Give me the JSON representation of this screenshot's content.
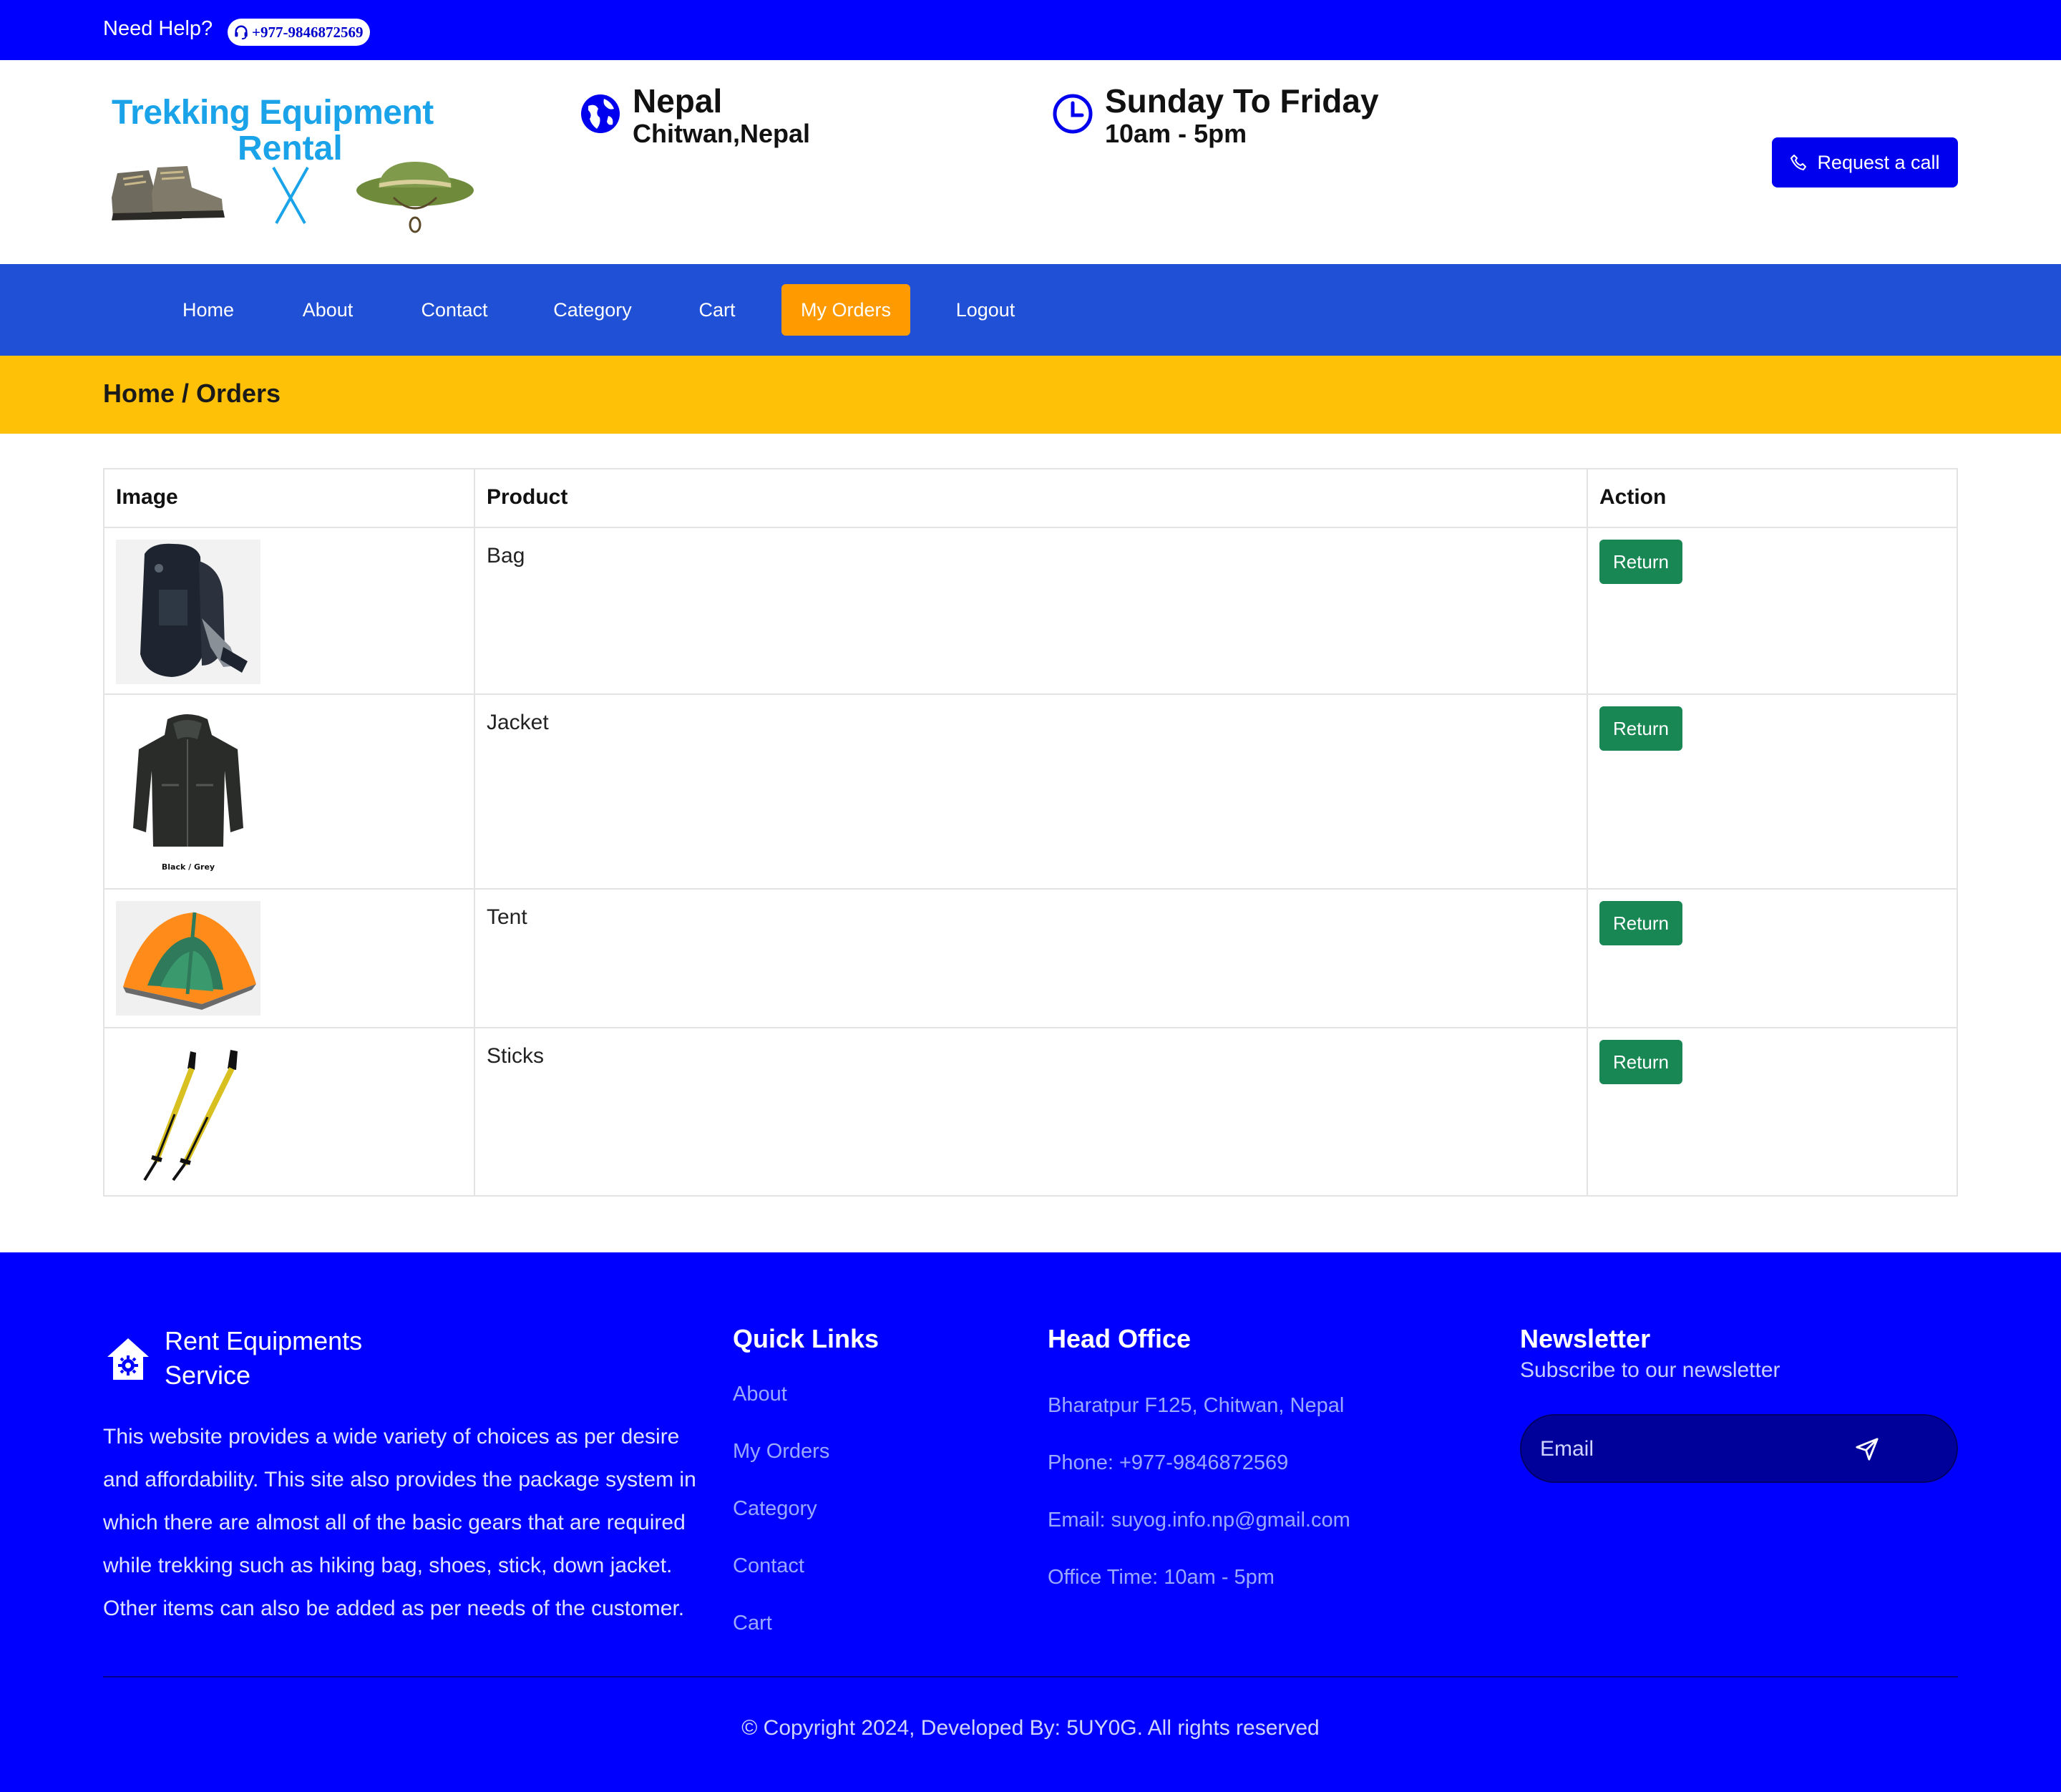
{
  "topbar": {
    "help": "Need Help?",
    "phone": "+977-9846872569"
  },
  "header": {
    "logo_line1": "Trekking Equipment",
    "logo_line2": "Rental",
    "location_title": "Nepal",
    "location_sub": "Chitwan,Nepal",
    "hours_title": "Sunday To Friday",
    "hours_sub": "10am - 5pm",
    "request_call": "Request a call"
  },
  "nav": {
    "items": [
      "Home",
      "About",
      "Contact",
      "Category",
      "Cart",
      "My Orders",
      "Logout"
    ],
    "active": "My Orders"
  },
  "breadcrumb": "Home / Orders",
  "table": {
    "headers": [
      "Image",
      "Product",
      "Action"
    ],
    "rows": [
      {
        "product": "Bag",
        "action": "Return"
      },
      {
        "product": "Jacket",
        "action": "Return"
      },
      {
        "product": "Tent",
        "action": "Return"
      },
      {
        "product": "Sticks",
        "action": "Return"
      }
    ],
    "jacket_caption": "Black / Grey"
  },
  "footer": {
    "brand_line1": "Rent Equipments",
    "brand_line2": "Service",
    "description": "This website provides a wide variety of choices as per desire and affordability. This site also provides the package system in which there are almost all of the basic gears that are required while trekking such as hiking bag, shoes, stick, down jacket. Other items can also be added as per needs of the customer.",
    "quick_links_title": "Quick Links",
    "quick_links": [
      "About",
      "My Orders",
      "Category",
      "Contact",
      "Cart"
    ],
    "office_title": "Head Office",
    "office": [
      "Bharatpur F125, Chitwan, Nepal",
      "Phone: +977-9846872569",
      "Email: suyog.info.np@gmail.com",
      "Office Time: 10am - 5pm"
    ],
    "newsletter_title": "Newsletter",
    "newsletter_sub": "Subscribe to our newsletter",
    "email_placeholder": "Email",
    "copyright": "© Copyright 2024, Developed By: 5UY0G. All rights reserved"
  },
  "colors": {
    "primary_blue": "#0000ff",
    "nav_blue": "#1f50d6",
    "active_orange": "#ff9a00",
    "breadcrumb_yellow": "#ffc107",
    "return_green": "#198754"
  }
}
